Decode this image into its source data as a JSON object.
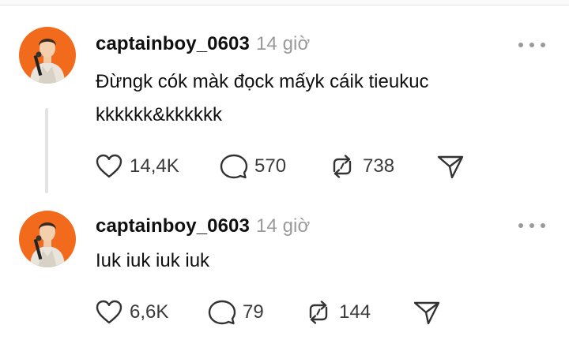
{
  "posts": [
    {
      "username": "captainboy_0603",
      "time": "14 giờ",
      "text_lines": [
        "Đừngk cók màk đọck mấyk cáik tieukuc",
        "kkkkkk&kkkkkk"
      ],
      "likes": "14,4K",
      "replies": "570",
      "reposts": "738"
    },
    {
      "username": "captainboy_0603",
      "time": "14 giờ",
      "text_lines": [
        "Iuk iuk iuk iuk"
      ],
      "likes": "6,6K",
      "replies": "79",
      "reposts": "144"
    }
  ],
  "icons": {
    "like": "heart-icon",
    "reply": "comment-bubble-icon",
    "repost": "repost-icon",
    "share": "send-icon",
    "more": "more-dots-icon"
  },
  "colors": {
    "avatar_background": "#f26a1b",
    "muted_text": "#9a9a9a",
    "thread_line": "#e3e3e3"
  }
}
